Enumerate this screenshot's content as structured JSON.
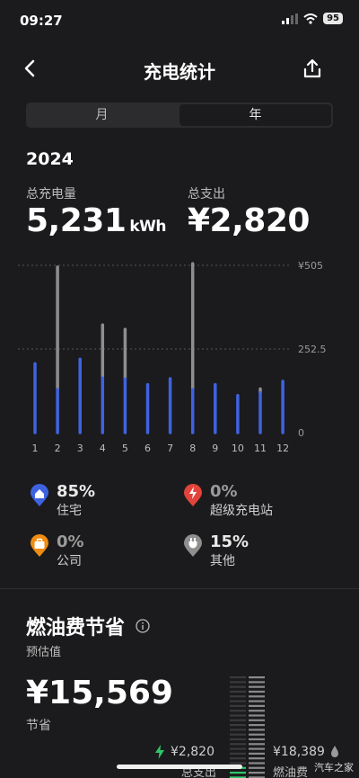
{
  "status": {
    "time": "09:27",
    "battery": "95"
  },
  "nav": {
    "title": "充电统计"
  },
  "segments": [
    "月",
    "年"
  ],
  "year": "2024",
  "summary": {
    "energy_label": "总充电量",
    "energy_value": "5,231",
    "energy_unit": "kWh",
    "cost_label": "总支出",
    "cost_value": "¥2,820"
  },
  "chart_data": {
    "type": "bar",
    "categories": [
      "1",
      "2",
      "3",
      "4",
      "5",
      "6",
      "7",
      "8",
      "9",
      "10",
      "11",
      "12"
    ],
    "ytick_labels": [
      "¥505",
      "252.5",
      "0"
    ],
    "ylim": [
      0,
      505
    ],
    "series": [
      {
        "role": "primary",
        "color": "#3f63e0",
        "values": [
          208,
          130,
          222,
          165,
          162,
          145,
          163,
          130,
          145,
          112,
          120,
          155
        ]
      },
      {
        "role": "secondary",
        "color": "#8e8e8e",
        "values": [
          0,
          370,
          0,
          160,
          150,
          0,
          0,
          380,
          0,
          0,
          12,
          0
        ]
      }
    ],
    "grid": true
  },
  "legend": [
    {
      "icon": "home-icon",
      "pct": "85%",
      "name": "住宅",
      "color": "#3f63e0",
      "dim": false
    },
    {
      "icon": "supercharger-icon",
      "pct": "0%",
      "name": "超级充电站",
      "color": "#e2443b",
      "dim": true
    },
    {
      "icon": "briefcase-icon",
      "pct": "0%",
      "name": "公司",
      "color": "#f08c12",
      "dim": true
    },
    {
      "icon": "plug-icon",
      "pct": "15%",
      "name": "其他",
      "color": "#8e8e8e",
      "dim": false
    }
  ],
  "fuel": {
    "title": "燃油费节省",
    "subtitle": "预估值",
    "savings": "¥15,569",
    "savings_label": "节省",
    "electric_cost": "¥2,820",
    "electric_label": "总支出",
    "fuel_cost": "¥18,389",
    "fuel_label": "燃油费"
  },
  "watermark": "汽车之家"
}
